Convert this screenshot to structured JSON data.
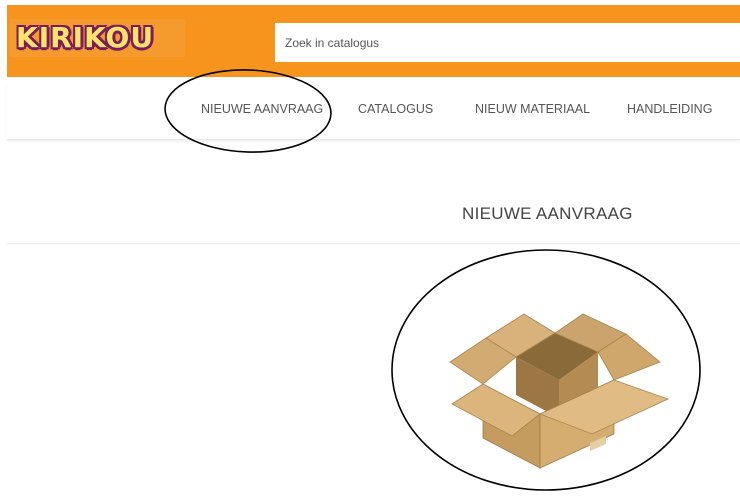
{
  "header": {
    "logo_text": "KIRIKOU",
    "search": {
      "placeholder": "Zoek in catalogus",
      "value": ""
    }
  },
  "nav": {
    "items": [
      {
        "label": "NIEUWE AANVRAAG"
      },
      {
        "label": "CATALOGUS"
      },
      {
        "label": "NIEUW MATERIAAL"
      },
      {
        "label": "HANDLEIDING"
      }
    ]
  },
  "main": {
    "title": "NIEUWE AANVRAAG",
    "image_icon": "cardboard-box-icon"
  },
  "colors": {
    "header_orange": "#f7941d",
    "box_cardboard": "#c9a062",
    "annotation_ink": "#000000"
  }
}
